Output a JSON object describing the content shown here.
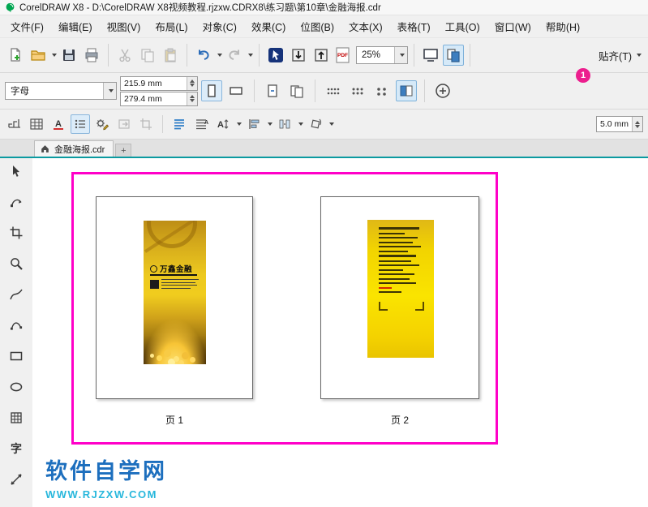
{
  "window": {
    "title": "CorelDRAW X8 - D:\\CorelDRAW X8视频教程.rjzxw.CDRX8\\练习题\\第10章\\金融海报.cdr"
  },
  "menubar": {
    "items": [
      "文件(F)",
      "编辑(E)",
      "视图(V)",
      "布局(L)",
      "对象(C)",
      "效果(C)",
      "位图(B)",
      "文本(X)",
      "表格(T)",
      "工具(O)",
      "窗口(W)",
      "帮助(H)"
    ]
  },
  "toolbar": {
    "zoom_level": "25%",
    "pdf_label": "PDF",
    "snap_label": "贴齐(T)",
    "callout_badge": "1"
  },
  "property_bar": {
    "paper_type": "字母",
    "paper_width": "215.9 mm",
    "paper_height": "279.4 mm"
  },
  "toolbar3": {
    "nudge_value": "5.0 mm"
  },
  "tabbar": {
    "document_tab": "金融海报.cdr",
    "new_page_label": "+"
  },
  "toolbox": {
    "text_tool_glyph": "字"
  },
  "sorter": {
    "poster1_title": "万鑫金融",
    "pages": [
      {
        "label": "页 1"
      },
      {
        "label": "页 2"
      }
    ]
  },
  "watermark": {
    "site_name": "软件自学网",
    "site_url": "WWW.RJZXW.COM"
  },
  "colors": {
    "accent_teal": "#0b9aa0",
    "sorter_border": "#ff00c8",
    "badge_pink": "#ec1e8e"
  }
}
